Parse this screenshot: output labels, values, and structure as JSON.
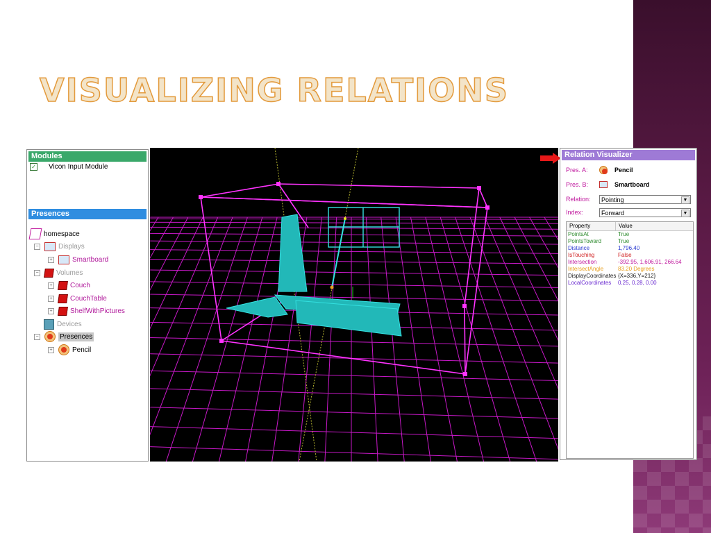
{
  "slide": {
    "title": "VISUALIZING RELATIONS"
  },
  "modules_panel": {
    "header": "Modules",
    "items": [
      {
        "label": "Vicon Input Module",
        "checked": true
      }
    ]
  },
  "presences_panel": {
    "header": "Presences",
    "tree": {
      "root": "homespace",
      "displays": "Displays",
      "smartboard": "Smartboard",
      "volumes": "Volumes",
      "couch": "Couch",
      "couchtable": "CouchTable",
      "shelf": "ShelfWithPictures",
      "devices": "Devices",
      "presences": "Presences",
      "pencil": "Pencil"
    }
  },
  "relation_visualizer": {
    "header": "Relation Visualizer",
    "pres_a_label": "Pres. A:",
    "pres_a_value": "Pencil",
    "pres_b_label": "Pres. B:",
    "pres_b_value": "Smartboard",
    "relation_label": "Relation:",
    "relation_value": "Pointing",
    "index_label": "Index:",
    "index_value": "Forward",
    "table": {
      "col_property": "Property",
      "col_value": "Value",
      "rows": [
        {
          "property": "PointsAt",
          "value": "True",
          "color": "#2e8b2e"
        },
        {
          "property": "PointsToward",
          "value": "True",
          "color": "#2e8b2e"
        },
        {
          "property": "Distance",
          "value": "1,796.40",
          "color": "#2a3ad0"
        },
        {
          "property": "IsTouching",
          "value": "False",
          "color": "#d02020"
        },
        {
          "property": "Intersection",
          "value": "-392.95, 1,606.91, 266.64",
          "color": "#c0199e"
        },
        {
          "property": "IntersectAngle",
          "value": "83.20 Degrees",
          "color": "#e8a020"
        },
        {
          "property": "DisplayCoordinates",
          "value": "{X=336,Y=212}",
          "color": "#202020"
        },
        {
          "property": "LocalCoordinates",
          "value": "0.25, 0.28, 0.00",
          "color": "#6a2ad0"
        }
      ]
    }
  },
  "colors": {
    "accent_magenta": "#ff00ff",
    "accent_cyan": "#33d6d6",
    "panel_green": "#3aa86a",
    "panel_blue": "#2f8de0",
    "panel_purple": "#9e7ad6",
    "title_outline": "#e39a3c",
    "arrow_red": "#e81818"
  }
}
